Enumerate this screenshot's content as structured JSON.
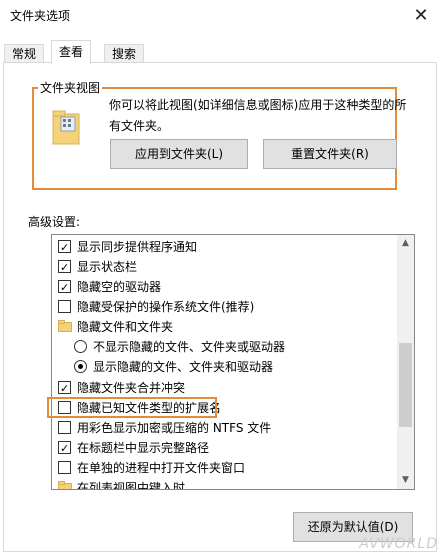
{
  "window": {
    "title": "文件夹选项"
  },
  "tabs": [
    {
      "label": "常规",
      "active": false
    },
    {
      "label": "查看",
      "active": true
    },
    {
      "label": "搜索",
      "active": false
    }
  ],
  "folder_view": {
    "group_label": "文件夹视图",
    "description": "你可以将此视图(如详细信息或图标)应用于这种类型的所有文件夹。",
    "apply_button": "应用到文件夹(L)",
    "reset_button": "重置文件夹(R)"
  },
  "advanced": {
    "label": "高级设置:",
    "items": [
      {
        "type": "checkbox",
        "checked": true,
        "label": "显示同步提供程序通知"
      },
      {
        "type": "checkbox",
        "checked": true,
        "label": "显示状态栏"
      },
      {
        "type": "checkbox",
        "checked": true,
        "label": "隐藏空的驱动器"
      },
      {
        "type": "checkbox",
        "checked": false,
        "label": "隐藏受保护的操作系统文件(推荐)"
      },
      {
        "type": "folder",
        "label": "隐藏文件和文件夹"
      },
      {
        "type": "radio",
        "checked": false,
        "label": "不显示隐藏的文件、文件夹或驱动器"
      },
      {
        "type": "radio",
        "checked": true,
        "label": "显示隐藏的文件、文件夹和驱动器"
      },
      {
        "type": "checkbox",
        "checked": true,
        "label": "隐藏文件夹合并冲突"
      },
      {
        "type": "checkbox",
        "checked": false,
        "label": "隐藏已知文件类型的扩展名"
      },
      {
        "type": "checkbox",
        "checked": false,
        "label": "用彩色显示加密或压缩的 NTFS 文件"
      },
      {
        "type": "checkbox",
        "checked": true,
        "label": "在标题栏中显示完整路径"
      },
      {
        "type": "checkbox",
        "checked": false,
        "label": "在单独的进程中打开文件夹窗口"
      },
      {
        "type": "folder",
        "label": "在列表视图中键入时"
      }
    ],
    "restore_button": "还原为默认值(D)"
  },
  "watermark": "AVWORLD",
  "colors": {
    "highlight": "#e58a3b"
  }
}
